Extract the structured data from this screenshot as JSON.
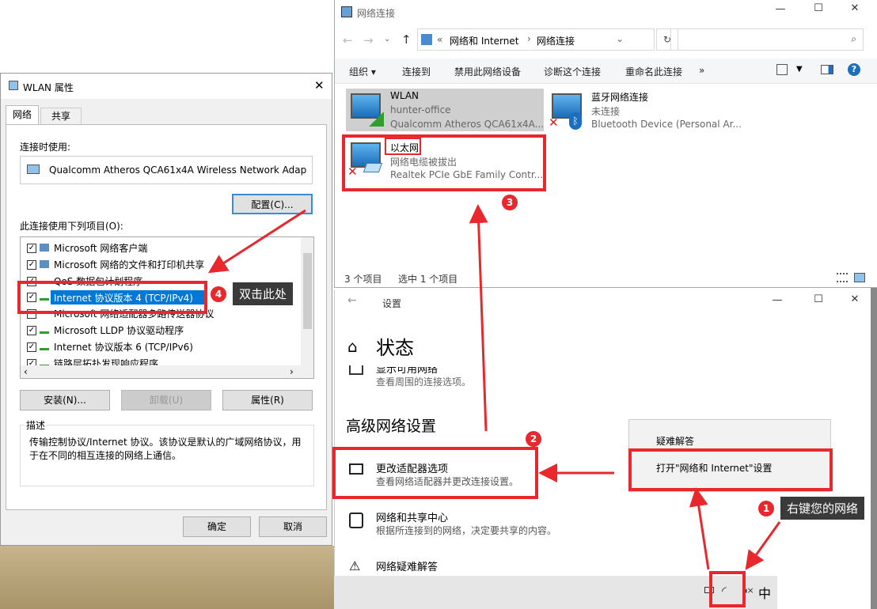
{
  "netconn": {
    "title": "网络连接",
    "address": {
      "sep": "«",
      "part1": "网络和 Internet",
      "arrow": "›",
      "part2": "网络连接"
    },
    "toolbar": {
      "organize": "组织 ▾",
      "connect": "连接到",
      "disable": "禁用此网络设备",
      "diagnose": "诊断这个连接",
      "rename": "重命名此连接",
      "more": "»"
    },
    "adapters": [
      {
        "name": "WLAN",
        "status": "hunter-office",
        "device": "Qualcomm Atheros QCA61x4A..."
      },
      {
        "name": "蓝牙网络连接",
        "status": "未连接",
        "device": "Bluetooth Device (Personal Ar..."
      },
      {
        "name": "以太网",
        "status": "网络电缆被拔出",
        "device": "Realtek PCIe GbE Family Contr..."
      }
    ],
    "statusbar": {
      "count": "3 个项目",
      "selected": "选中 1 个项目"
    }
  },
  "wlan": {
    "title": "WLAN 属性",
    "tabs": [
      "网络",
      "共享"
    ],
    "connect_using": "连接时使用:",
    "adapter": "Qualcomm Atheros QCA61x4A Wireless Network Adap",
    "config": "配置(C)...",
    "items_label": "此连接使用下列项目(O):",
    "items": [
      "Microsoft 网络客户端",
      "Microsoft 网络的文件和打印机共享",
      "QoS 数据包计划程序",
      "Internet 协议版本 4 (TCP/IPv4)",
      "Microsoft 网络适配器多路传送器协议",
      "Microsoft LLDP 协议驱动程序",
      "Internet 协议版本 6 (TCP/IPv6)",
      "链路层拓扑发现响应程序"
    ],
    "install": "安装(N)...",
    "uninstall": "卸载(U)",
    "properties": "属性(R)",
    "desc_title": "描述",
    "desc": "传输控制协议/Internet 协议。该协议是默认的广域网络协议，用于在不同的相互连接的网络上通信。",
    "ok": "确定",
    "cancel": "取消"
  },
  "settings": {
    "title": "设置",
    "heading": "状态",
    "clip_item": "显示可用网络",
    "clip_desc": "查看周围的连接选项。",
    "section": "高级网络设置",
    "items": [
      {
        "title": "更改适配器选项",
        "desc": "查看网络适配器并更改连接设置。"
      },
      {
        "title": "网络和共享中心",
        "desc": "根据所连接到的网络，决定要共享的内容。"
      },
      {
        "title": "网络疑难解答",
        "desc": ""
      }
    ]
  },
  "context_menu": {
    "items": [
      "疑难解答",
      "打开\"网络和 Internet\"设置"
    ]
  },
  "taskbar": {
    "ime": "中"
  },
  "annotations": {
    "n1": "1",
    "n2": "2",
    "n3": "3",
    "n4": "4",
    "tip1": "右键您的网络",
    "tip4": "双击此处"
  }
}
